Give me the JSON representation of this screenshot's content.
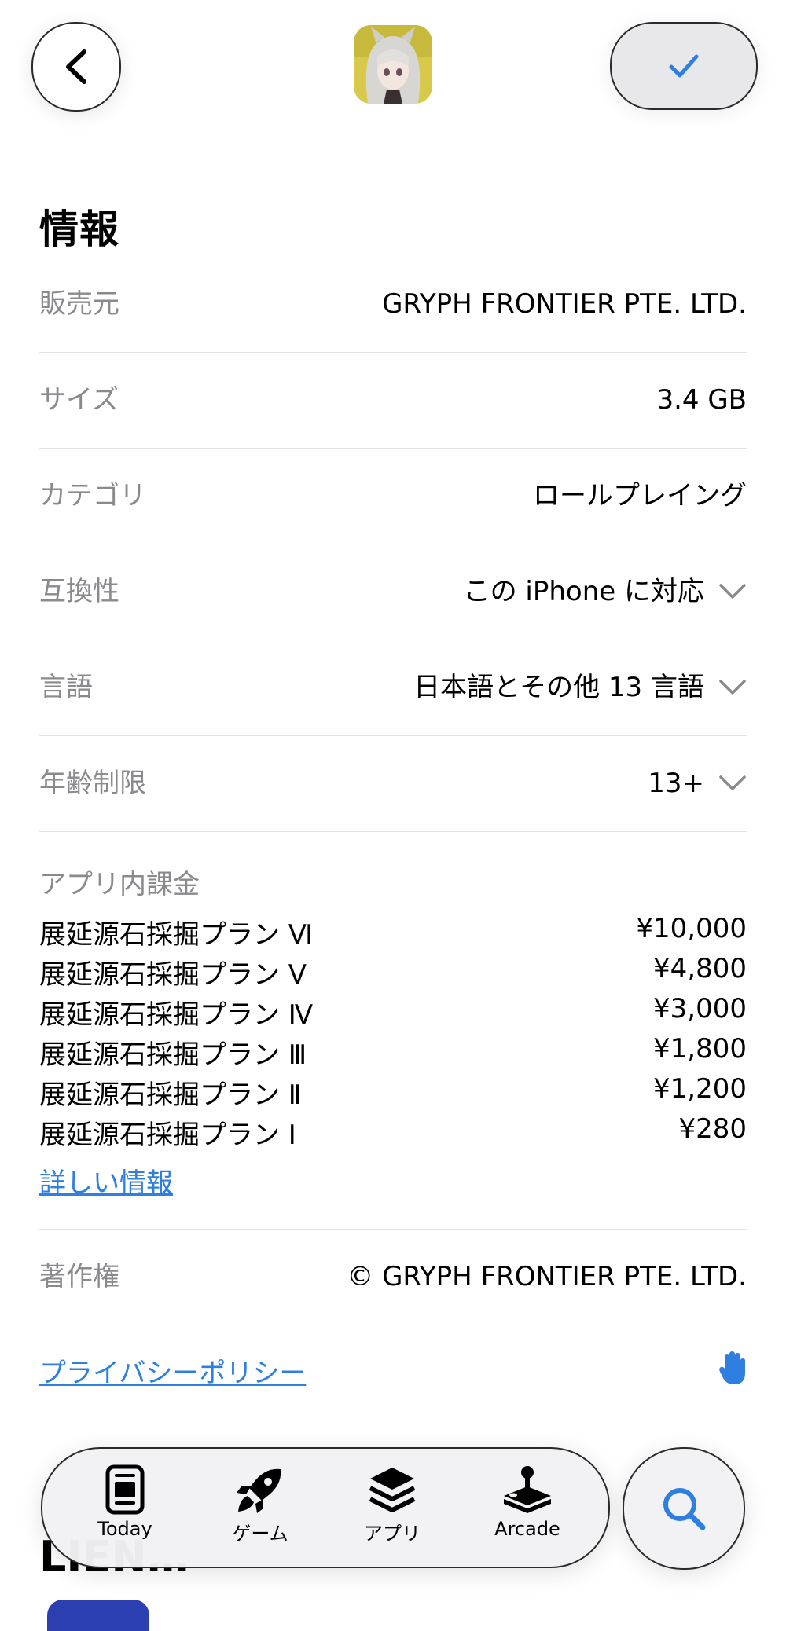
{
  "header": {
    "back_icon": "chevron-left-icon",
    "check_icon": "checkmark-icon"
  },
  "section_title": "情報",
  "info_rows": {
    "seller": {
      "label": "販売元",
      "value": "GRYPH FRONTIER PTE. LTD."
    },
    "size": {
      "label": "サイズ",
      "value": "3.4 GB"
    },
    "category": {
      "label": "カテゴリ",
      "value": "ロールプレイング"
    },
    "compat": {
      "label": "互換性",
      "value": "この iPhone に対応"
    },
    "language": {
      "label": "言語",
      "value": "日本語とその他 13 言語"
    },
    "age": {
      "label": "年齢制限",
      "value": "13+"
    }
  },
  "iap": {
    "title": "アプリ内課金",
    "items": [
      {
        "name": "展延源石採掘プラン Ⅵ",
        "price": "¥10,000"
      },
      {
        "name": "展延源石採掘プラン Ⅴ",
        "price": "¥4,800"
      },
      {
        "name": "展延源石採掘プラン Ⅳ",
        "price": "¥3,000"
      },
      {
        "name": "展延源石採掘プラン Ⅲ",
        "price": "¥1,800"
      },
      {
        "name": "展延源石採掘プラン Ⅱ",
        "price": "¥1,200"
      },
      {
        "name": "展延源石採掘プラン Ⅰ",
        "price": "¥280"
      }
    ],
    "more_link": "詳しい情報"
  },
  "copyright": {
    "label": "著作権",
    "value": "© GRYPH FRONTIER PTE. LTD."
  },
  "privacy": {
    "link": "プライバシーポリシー",
    "icon": "hand-raised-icon"
  },
  "behind_heading": "LIEN…",
  "tabbar": {
    "tabs": [
      {
        "label": "Today",
        "icon": "today-icon"
      },
      {
        "label": "ゲーム",
        "icon": "rocket-icon"
      },
      {
        "label": "アプリ",
        "icon": "apps-stack-icon"
      },
      {
        "label": "Arcade",
        "icon": "arcade-joystick-icon"
      }
    ],
    "search_icon": "search-icon"
  },
  "colors": {
    "accent": "#2f7fe0",
    "secondary_text": "#8a8a8e",
    "divider": "#e3e3e6"
  }
}
